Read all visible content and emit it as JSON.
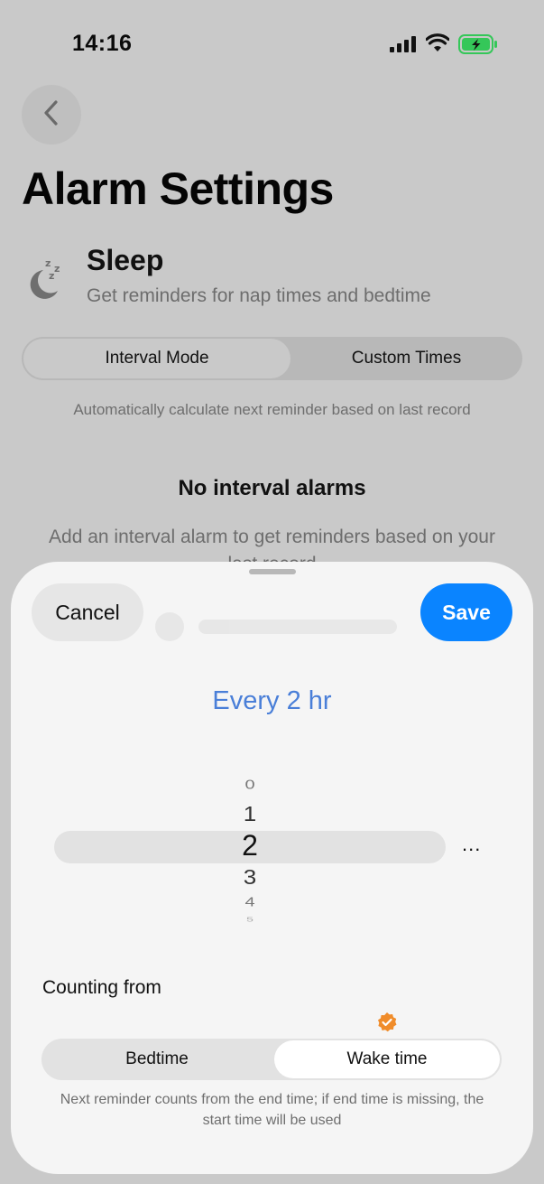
{
  "status_bar": {
    "time": "14:16"
  },
  "header": {
    "title": "Alarm Settings"
  },
  "section": {
    "title": "Sleep",
    "subtitle": "Get reminders for nap times and bedtime"
  },
  "mode_toggle": {
    "options": [
      "Interval Mode",
      "Custom Times"
    ],
    "selected": "Interval Mode",
    "description": "Automatically calculate next reminder based on last record"
  },
  "empty_state": {
    "title": "No interval alarms",
    "description": "Add an interval alarm to get reminders based on your last record"
  },
  "sheet": {
    "cancel_label": "Cancel",
    "save_label": "Save",
    "interval_summary": "Every 2 hr",
    "picker": {
      "items": [
        "0",
        "1",
        "2",
        "3",
        "4",
        "5"
      ],
      "selected": "2",
      "more_label": "..."
    },
    "counting_from": {
      "label": "Counting from",
      "options": [
        "Bedtime",
        "Wake time"
      ],
      "selected": "Wake time",
      "note": "Next reminder counts from the end time; if end time is missing, the start time will be used"
    }
  },
  "colors": {
    "accent_blue": "#0a84ff",
    "summary_blue": "#4a7fd8",
    "badge_orange": "#f08c2a",
    "battery_green": "#35c759"
  }
}
